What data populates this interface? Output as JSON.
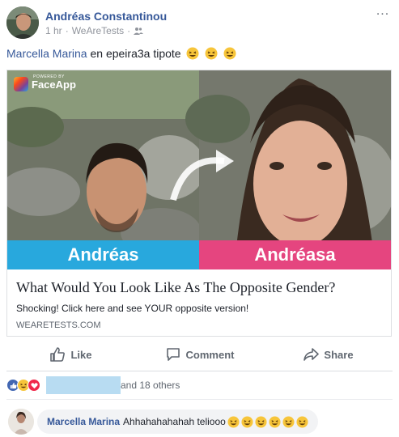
{
  "post": {
    "author": "Andréas Constantinou",
    "time": "1 hr",
    "source": "WeAreTests",
    "more_label": "...",
    "caption": {
      "tag": "Marcella Marina",
      "text": "en epeira3a tipote"
    }
  },
  "card": {
    "badge_sub": "POWERED BY",
    "badge": "FaceApp",
    "left_name": "Andréas",
    "right_name": "Andréasa",
    "title": "What Would You Look Like As The Opposite Gender?",
    "description": "Shocking! Click here and see YOUR opposite version!",
    "domain": "WEARETESTS.COM"
  },
  "actions": {
    "like": "Like",
    "comment": "Comment",
    "share": "Share"
  },
  "reactions": {
    "others": "and 18 others"
  },
  "comment": {
    "author": "Marcella Marina",
    "text": "Ahhahahahahah teliooo"
  },
  "colors": {
    "link": "#365899",
    "left_band": "#28a8dd",
    "right_band": "#e5457f"
  }
}
